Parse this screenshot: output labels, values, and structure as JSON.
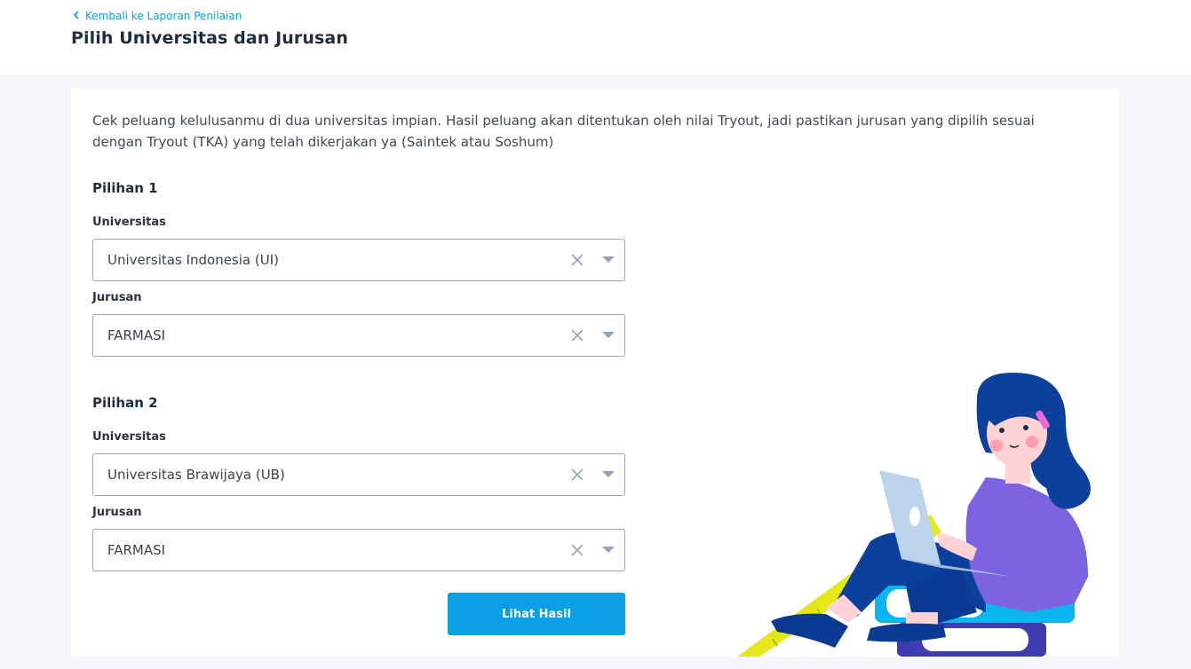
{
  "header": {
    "back_label": "Kembali ke Laporan Penilaian",
    "title": "Pilih Universitas dan Jurusan"
  },
  "intro_text": "Cek peluang kelulusanmu di dua universitas impian. Hasil peluang akan ditentukan oleh nilai Tryout, jadi pastikan jurusan yang dipilih sesuai dengan Tryout (TKA) yang telah dikerjakan ya (Saintek atau Soshum)",
  "choices": [
    {
      "title": "Pilihan 1",
      "university_label": "Universitas",
      "university_value": "Universitas Indonesia (UI)",
      "major_label": "Jurusan",
      "major_value": "FARMASI"
    },
    {
      "title": "Pilihan 2",
      "university_label": "Universitas",
      "university_value": "Universitas Brawijaya (UB)",
      "major_label": "Jurusan",
      "major_value": "FARMASI"
    }
  ],
  "submit_label": "Lihat Hasil",
  "colors": {
    "accent": "#0a9ee4",
    "title": "#1f2d3d",
    "border": "#9aa5b1",
    "icon": "#8fa6be"
  },
  "icons": {
    "back": "chevron-left-icon",
    "clear": "close-icon",
    "dropdown": "caret-down-icon"
  }
}
